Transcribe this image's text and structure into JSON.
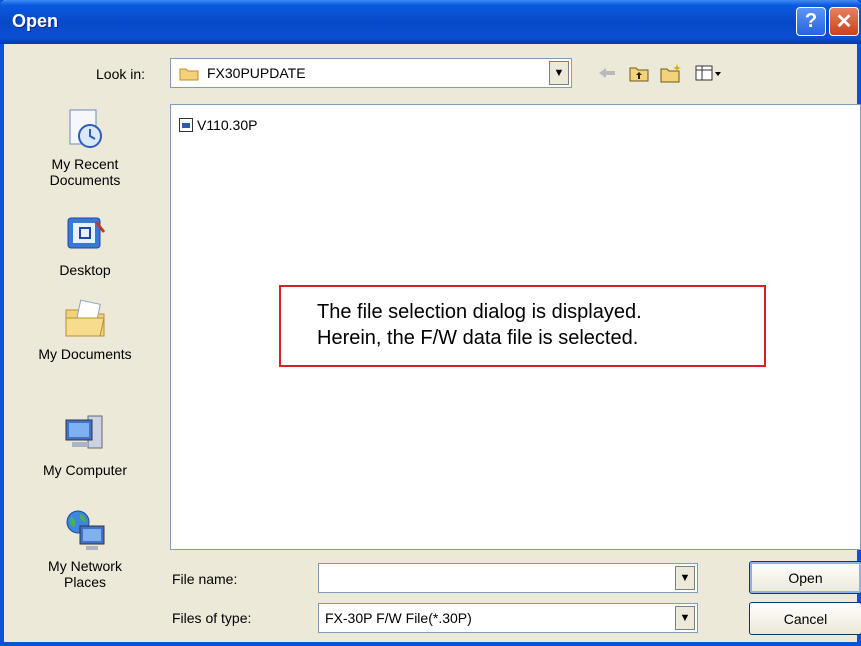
{
  "window": {
    "title": "Open"
  },
  "titlebar": {
    "help_glyph": "?",
    "close_glyph": "✕"
  },
  "lookin": {
    "label": "Look in:",
    "value": "FX30PUPDATE"
  },
  "toolbar": {
    "icons": [
      "back-icon",
      "up-folder-icon",
      "new-folder-icon",
      "views-menu-icon"
    ]
  },
  "places": [
    {
      "label_1": "My Recent",
      "label_2": "Documents"
    },
    {
      "label_1": "Desktop",
      "label_2": ""
    },
    {
      "label_1": "My Documents",
      "label_2": ""
    },
    {
      "label_1": "My Computer",
      "label_2": ""
    },
    {
      "label_1": "My Network",
      "label_2": "Places"
    }
  ],
  "files": [
    {
      "name": "V110.30P"
    }
  ],
  "note": {
    "line1": "The file selection dialog is displayed.",
    "line2": "Herein, the F/W data file is selected.",
    "border_color": "#d8202a"
  },
  "filename": {
    "label": "File name:",
    "value": ""
  },
  "filetype": {
    "label": "Files of type:",
    "value": "FX-30P F/W File(*.30P)"
  },
  "buttons": {
    "open": "Open",
    "cancel": "Cancel"
  },
  "colors": {
    "title_blue": "#0848c8",
    "dialog_bg": "#ece9d8",
    "close_red": "#c9411a"
  }
}
